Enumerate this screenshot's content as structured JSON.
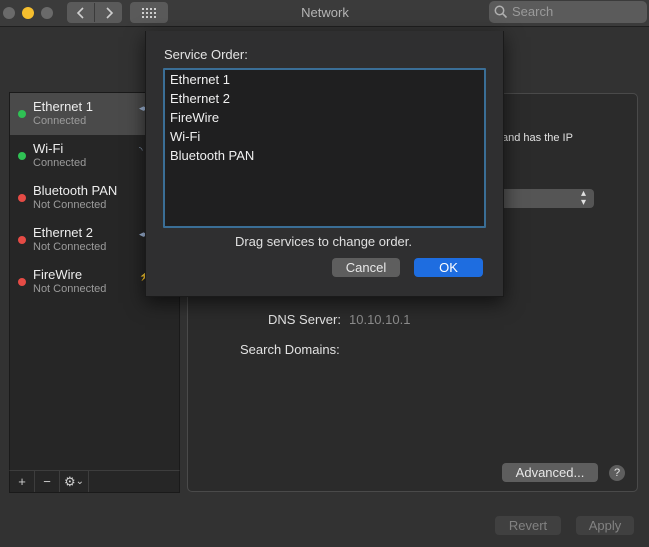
{
  "window": {
    "title": "Network"
  },
  "search": {
    "placeholder": "Search"
  },
  "toolbar": {
    "grid_icon": "grid-icon",
    "back_icon": "chevron-left-icon",
    "forward_icon": "chevron-right-icon"
  },
  "colors": {
    "connected": "#2fc154",
    "not_connected": "#e54b45",
    "accent": "#1e6de0",
    "focus_ring": "#3a6e96"
  },
  "sidebar": {
    "services": [
      {
        "name": "Ethernet 1",
        "status": "Connected",
        "state": "connected",
        "selected": true
      },
      {
        "name": "Wi-Fi",
        "status": "Connected",
        "state": "connected",
        "selected": false
      },
      {
        "name": "Bluetooth PAN",
        "status": "Not Connected",
        "state": "not_connected",
        "selected": false
      },
      {
        "name": "Ethernet 2",
        "status": "Not Connected",
        "state": "not_connected",
        "selected": false
      },
      {
        "name": "FireWire",
        "status": "Not Connected",
        "state": "not_connected",
        "selected": false
      }
    ],
    "tools": {
      "add": "+",
      "remove": "−",
      "gear": "⚙",
      "gear_caret": "⌄"
    }
  },
  "main": {
    "partial_text": "and has the IP",
    "dns_label": "DNS Server:",
    "dns_value": "10.10.10.1",
    "search_domains_label": "Search Domains:",
    "advanced_label": "Advanced...",
    "help_label": "?"
  },
  "footer": {
    "revert_label": "Revert",
    "apply_label": "Apply"
  },
  "sheet": {
    "title": "Service Order:",
    "order": [
      "Ethernet 1",
      "Ethernet 2",
      "FireWire",
      "Wi-Fi",
      "Bluetooth PAN"
    ],
    "hint": "Drag services to change order.",
    "cancel_label": "Cancel",
    "ok_label": "OK"
  }
}
